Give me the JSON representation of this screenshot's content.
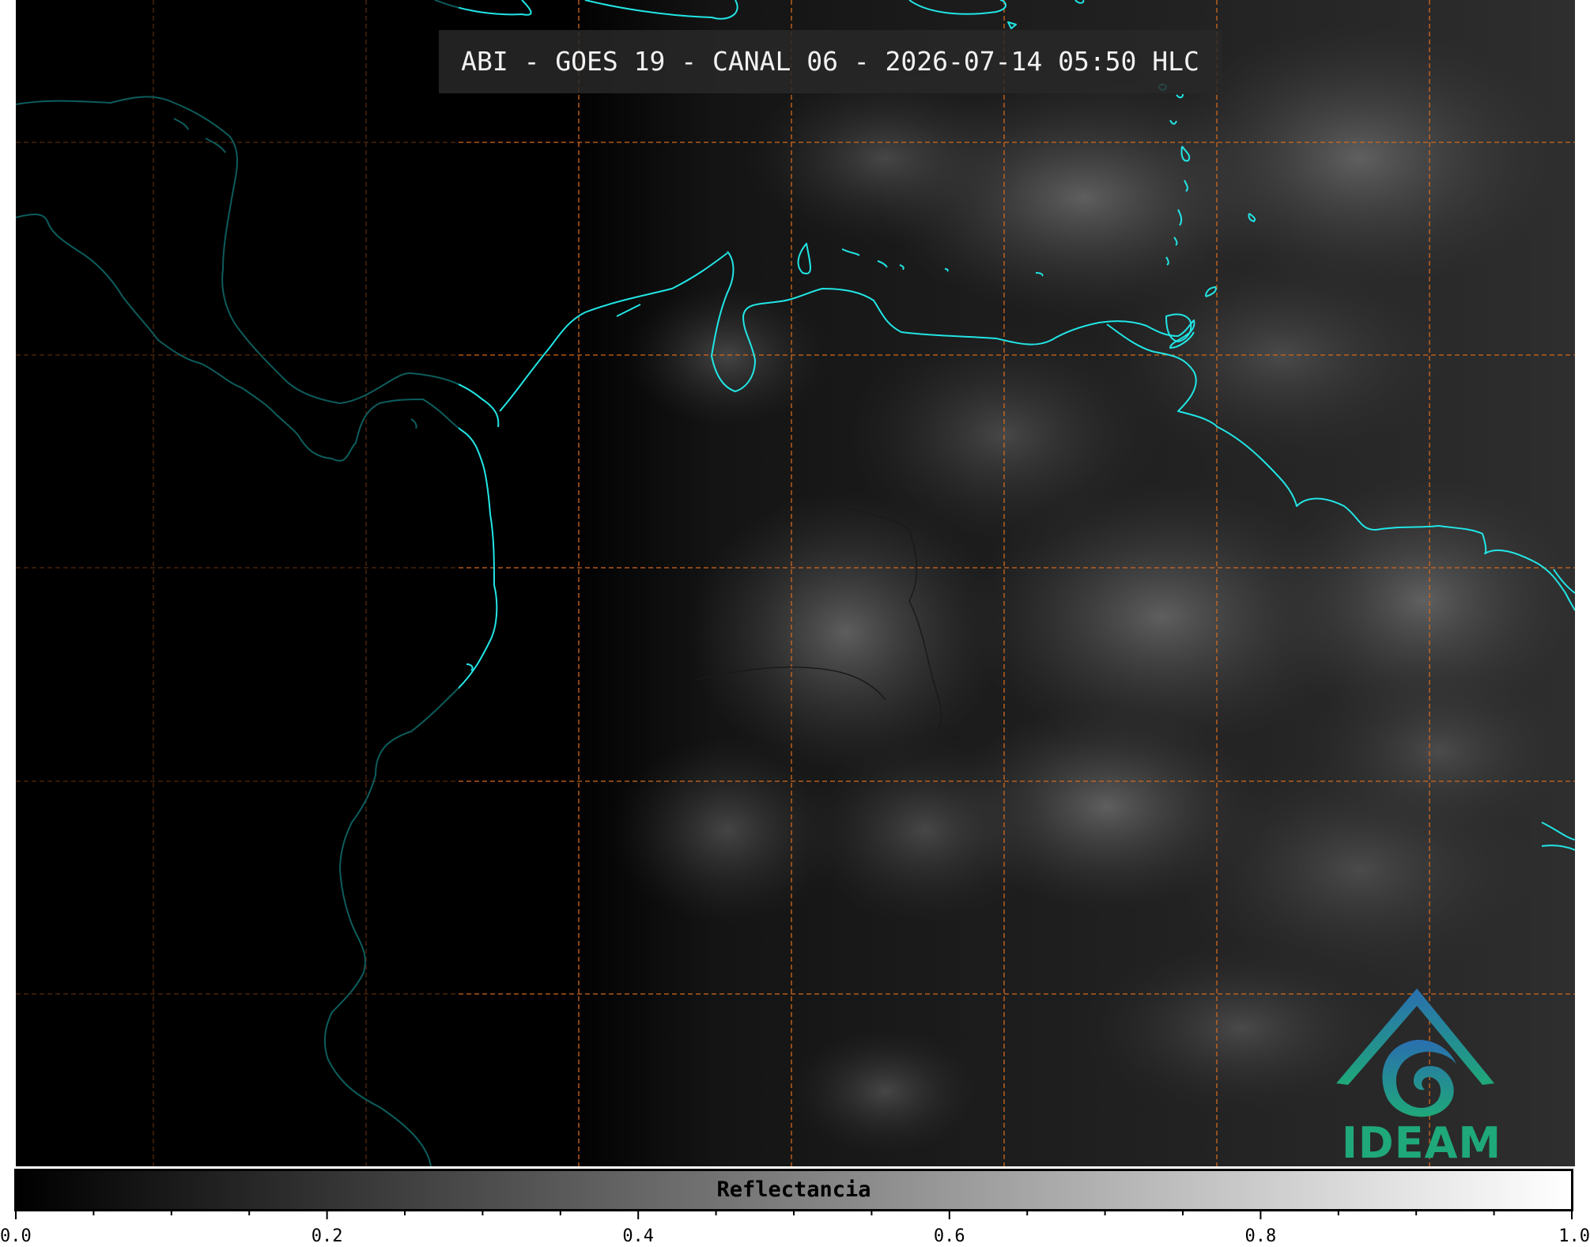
{
  "title": "ABI - GOES 19 - CANAL 06 - 2026-07-14 05:50 HLC",
  "colors": {
    "coastline": "#22e5e5",
    "grid": "#d2691e",
    "background": "#000000",
    "logo_green": "#1fa879",
    "logo_blue": "#2a6fb0"
  },
  "logo": {
    "text": "IDEAM",
    "icon": "ideam-logo-icon"
  },
  "colorbar": {
    "label": "Reflectancia",
    "min": 0.0,
    "max": 1.0,
    "tick_labels": [
      "0.0",
      "0.2",
      "0.4",
      "0.6",
      "0.8",
      "1.0"
    ],
    "tick_values": [
      0.0,
      0.2,
      0.4,
      0.6,
      0.8,
      1.0
    ],
    "minor_tick_step": 0.05,
    "colormap": "grayscale"
  }
}
